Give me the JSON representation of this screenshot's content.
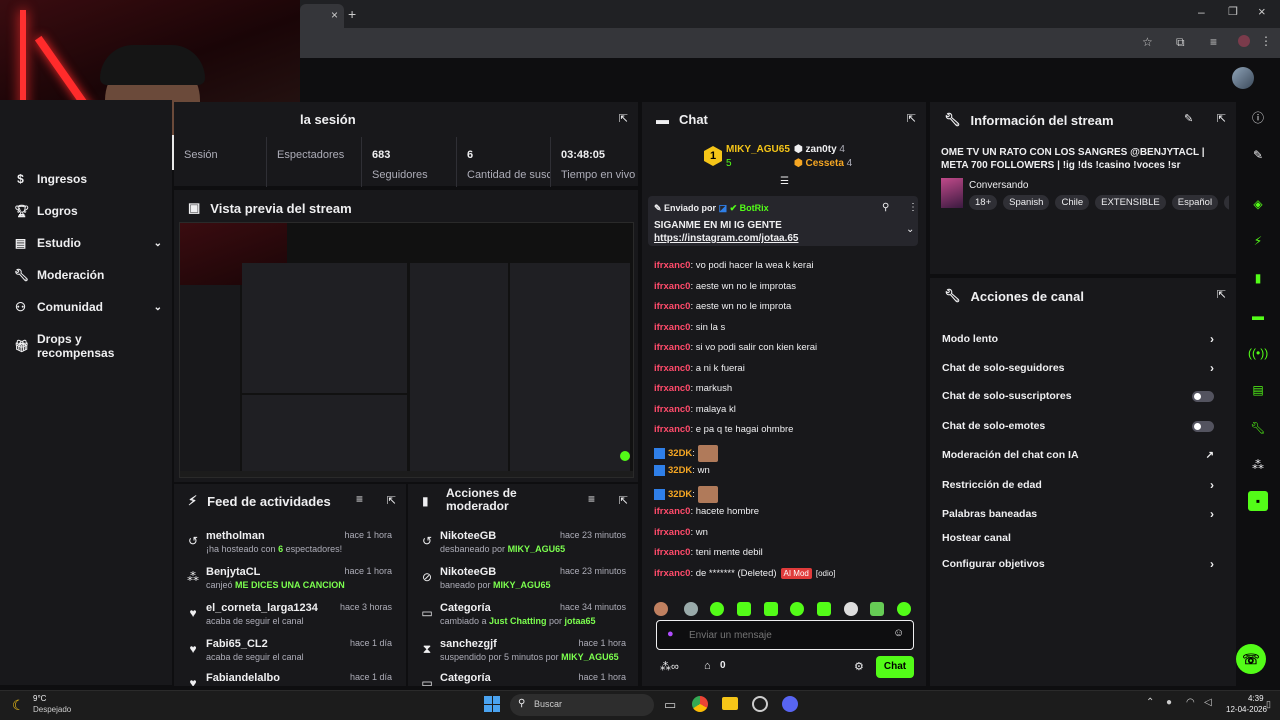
{
  "session": {
    "title": "la sesión",
    "stats": [
      {
        "value": "",
        "label": "Sesión"
      },
      {
        "value": "",
        "label": "Espectadores"
      },
      {
        "value": "683",
        "label": "Seguidores"
      },
      {
        "value": "6",
        "label": "Cantidad de suscripciones"
      },
      {
        "value": "03:48:05",
        "label": "Tiempo en vivo"
      }
    ]
  },
  "sidebar": {
    "items": [
      {
        "label": "Ingresos",
        "icon": "money-icon"
      },
      {
        "label": "Logros",
        "icon": "trophy-icon"
      },
      {
        "label": "Estudio",
        "icon": "studio-icon"
      },
      {
        "label": "Moderación",
        "icon": "wrench-icon"
      },
      {
        "label": "Comunidad",
        "icon": "people-icon"
      },
      {
        "label": "Drops y recompensas",
        "icon": "gift-icon"
      }
    ]
  },
  "preview": {
    "title": "Vista previa del stream"
  },
  "feed": {
    "title": "Feed de actividades",
    "rows": [
      {
        "name": "metholman",
        "time": "hace 1 hora",
        "pre": "¡ha hosteado con ",
        "hl": "6",
        "post": " espectadores!",
        "icon": "host-icon"
      },
      {
        "name": "BenjytaCL",
        "time": "hace 1 hora",
        "pre": "canjeó ",
        "hl": "ME DICES UNA CANCION",
        "post": "",
        "icon": "points-icon"
      },
      {
        "name": "el_corneta_larga1234",
        "time": "hace 3 horas",
        "pre": "acaba de seguir el canal",
        "hl": "",
        "post": "",
        "icon": "heart-icon"
      },
      {
        "name": "Fabi65_CL2",
        "time": "hace 1 día",
        "pre": "acaba de seguir el canal",
        "hl": "",
        "post": "",
        "icon": "heart-icon"
      },
      {
        "name": "Fabiandelalbo",
        "time": "hace 1 día",
        "pre": "",
        "hl": "",
        "post": "",
        "icon": "heart-icon"
      }
    ]
  },
  "modactions": {
    "title1": "Acciones de",
    "title2": "moderador",
    "rows": [
      {
        "name": "NikoteeGB",
        "time": "hace 23 minutos",
        "pre": "desbaneado por ",
        "hl": "MIKY_AGU65",
        "mid": "",
        "hl2": "",
        "icon": "unban-icon"
      },
      {
        "name": "NikoteeGB",
        "time": "hace 23 minutos",
        "pre": "baneado por ",
        "hl": "MIKY_AGU65",
        "mid": "",
        "hl2": "",
        "icon": "ban-icon"
      },
      {
        "name": "Categoría",
        "time": "hace 34 minutos",
        "pre": "cambiado a ",
        "hl": "Just Chatting",
        "mid": " por ",
        "hl2": "jotaa65",
        "icon": "category-icon"
      },
      {
        "name": "sanchezgjf",
        "time": "hace 1 hora",
        "pre": "suspendido por 5 minutos por ",
        "hl": "MIKY_AGU65",
        "mid": "",
        "hl2": "",
        "icon": "hourglass-icon"
      },
      {
        "name": "Categoría",
        "time": "hace 1 hora",
        "pre": "",
        "hl": "",
        "mid": "",
        "hl2": "",
        "icon": "category-icon"
      }
    ]
  },
  "chat": {
    "title": "Chat",
    "leaderboard": [
      {
        "rank": "1",
        "name": "MIKY_AGU65",
        "count": "5"
      },
      {
        "rank": "",
        "name": "zan0ty",
        "count": "4"
      },
      {
        "rank": "",
        "name": "Cesseta",
        "count": "4"
      }
    ],
    "pinned": {
      "sent_by": "Enviado por",
      "bot": "BotRix",
      "text": "SIGANME EN MI IG GENTE",
      "link": "https://instagram.com/jotaa.65"
    },
    "messages": [
      {
        "user": "ifrxanc0",
        "text": "vo podi hacer la wea k kerai"
      },
      {
        "user": "ifrxanc0",
        "text": "aeste wn no le improtas"
      },
      {
        "user": "ifrxanc0",
        "text": "aeste wn no le improta"
      },
      {
        "user": "ifrxanc0",
        "text": "sin la s"
      },
      {
        "user": "ifrxanc0",
        "text": "si vo podi salir con kien kerai"
      },
      {
        "user": "ifrxanc0",
        "text": "a ni k fuerai"
      },
      {
        "user": "ifrxanc0",
        "text": "markush"
      },
      {
        "user": "ifrxanc0",
        "text": "malaya kl"
      },
      {
        "user": "ifrxanc0",
        "text": "e pa q te hagai ohmbre"
      },
      {
        "user": "32DK",
        "text": ""
      },
      {
        "user": "32DK",
        "text": "wn"
      },
      {
        "user": "32DK",
        "text": ""
      },
      {
        "user": "ifrxanc0",
        "text": "hacete hombre"
      },
      {
        "user": "ifrxanc0",
        "text": "wn"
      },
      {
        "user": "ifrxanc0",
        "text": "teni mente debil"
      },
      {
        "user": "ifrxanc0",
        "text": "de ******* (Deleted)"
      }
    ],
    "deleted_badge": "AI Mod",
    "deleted_tail": "[odio]",
    "input_placeholder": "Enviar un mensaje",
    "points": "0",
    "send_label": "Chat"
  },
  "info": {
    "title": "Información del stream",
    "stream_title": "OME TV UN RATO CON LOS SANGRES @BENJYTACL | META 700 FOLLOWERS | !ig !ds !casino !voces !sr",
    "category": "Conversando",
    "tags": [
      "18+",
      "Spanish",
      "Chile",
      "EXTENSIBLE",
      "Español",
      "c"
    ]
  },
  "channel": {
    "title": "Acciones de canal",
    "rows": [
      {
        "label": "Modo lento",
        "ctl": "chevron"
      },
      {
        "label": "Chat de solo-seguidores",
        "ctl": "chevron"
      },
      {
        "label": "Chat de solo-suscriptores",
        "ctl": "toggle"
      },
      {
        "label": "Chat de solo-emotes",
        "ctl": "toggle"
      },
      {
        "label": "Moderación del chat con IA",
        "ctl": "external"
      },
      {
        "label": "Restricción de edad",
        "ctl": "chevron"
      },
      {
        "label": "Palabras baneadas",
        "ctl": "chevron"
      },
      {
        "label": "Hostear canal",
        "ctl": "none"
      },
      {
        "label": "Configurar objetivos",
        "ctl": "chevron"
      }
    ]
  },
  "taskbar": {
    "temp": "9°C",
    "weather": "Despejado",
    "search": "Buscar",
    "time": "4:39",
    "date": "12-04-2026"
  },
  "colors": {
    "accent": "#53fc18",
    "bg": "#0e0e10",
    "panel": "#18181b"
  }
}
